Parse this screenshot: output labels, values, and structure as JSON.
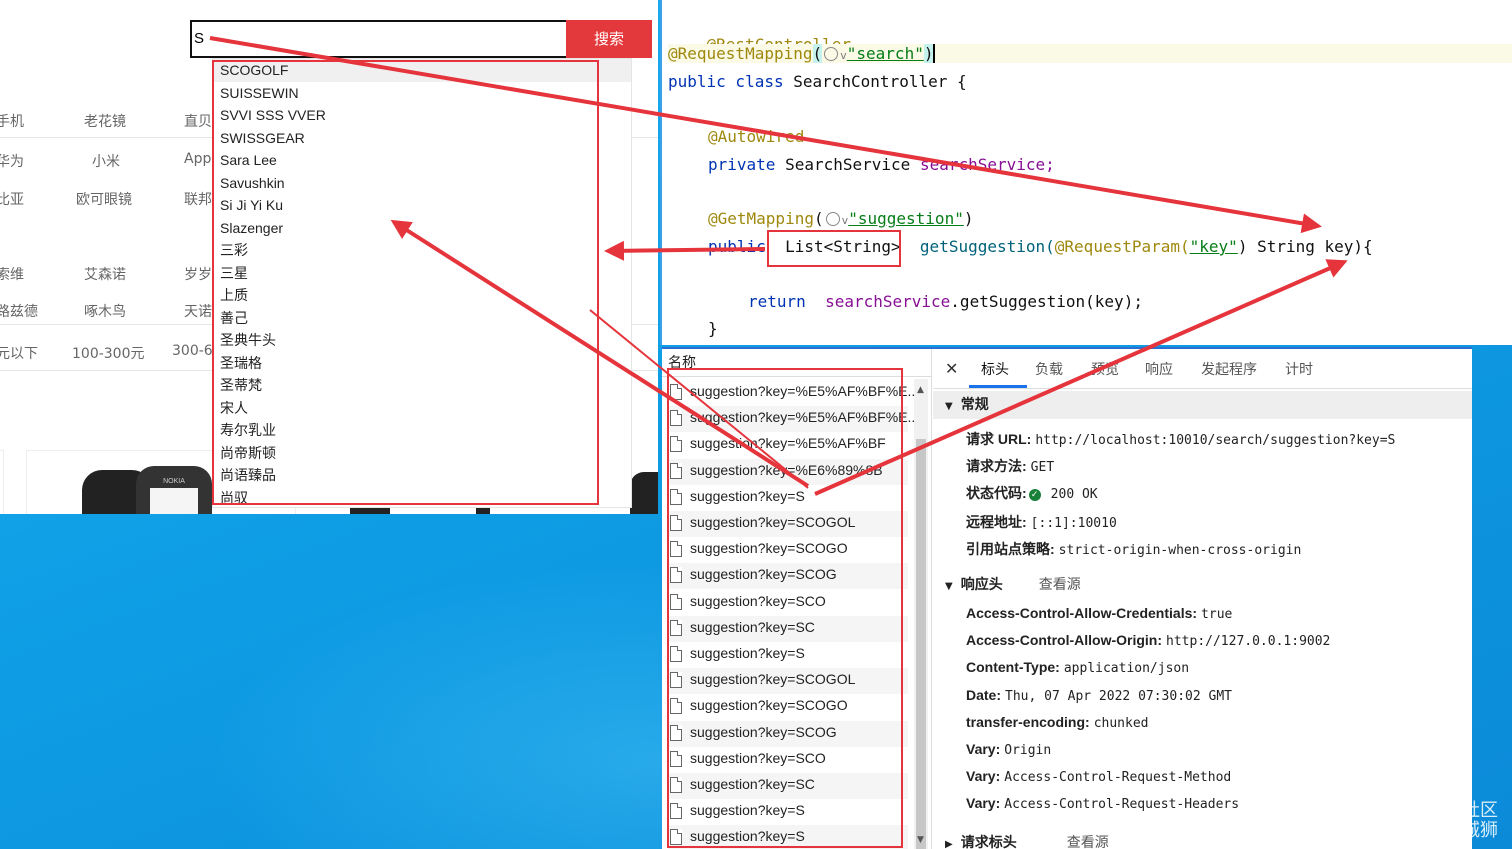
{
  "shop": {
    "search_value": "S",
    "search_button": "搜索",
    "brand_rows": [
      [
        "手机",
        "老花镜",
        "直贝"
      ],
      [
        "华为",
        "小米",
        "App"
      ],
      [
        "比亚",
        "欧可眼镜",
        "联邦"
      ],
      [
        "索维",
        "艾森诺",
        "岁岁"
      ],
      [
        "路兹德",
        "啄木鸟",
        "天诺"
      ],
      [
        "元以下",
        "100-300元",
        "300-6"
      ]
    ],
    "suggestions": [
      "SCOGOLF",
      "SUISSEWIN",
      "SVVI SSS VVER",
      "SWISSGEAR",
      "Sara Lee",
      "Savushkin",
      "Si Ji Yi Ku",
      "Slazenger",
      "三彩",
      "三星",
      "上质",
      "善己",
      "圣典牛头",
      "圣瑞格",
      "圣蒂梵",
      "宋人",
      "寿尔乳业",
      "尚帝斯顿",
      "尚语臻品",
      "尚驭"
    ],
    "phone_brand": "NOKIA"
  },
  "code": {
    "annotation_rest": "@RestController",
    "annotation_mapping": "@RequestMapping",
    "mapping_path": "\"search\"",
    "class_decl_kw": "public class",
    "class_name": "SearchController {",
    "autowired": "@Autowired",
    "private_kw": "private",
    "service_type": "SearchService",
    "service_field": "searchService;",
    "get_mapping": "@GetMapping",
    "get_path": "\"suggestion\"",
    "public_kw": "public",
    "return_type": "List<String>",
    "method_name": "getSuggestion(",
    "request_param": "@RequestParam(",
    "param_key": "\"key\"",
    "param_rest": ") String key){",
    "return_kw": "return",
    "return_expr_obj": "searchService",
    "return_expr_rest": ".getSuggestion(key);",
    "closing": "}"
  },
  "devtools": {
    "name_header": "名称",
    "requests": [
      "suggestion?key=%E5%AF%BF%E...",
      "suggestion?key=%E5%AF%BF%E...",
      "suggestion?key=%E5%AF%BF",
      "suggestion?key=%E6%89%8B",
      "suggestion?key=S",
      "suggestion?key=SCOGOL",
      "suggestion?key=SCOGO",
      "suggestion?key=SCOG",
      "suggestion?key=SCO",
      "suggestion?key=SC",
      "suggestion?key=S",
      "suggestion?key=SCOGOL",
      "suggestion?key=SCOGO",
      "suggestion?key=SCOG",
      "suggestion?key=SCO",
      "suggestion?key=SC",
      "suggestion?key=S",
      "suggestion?key=S"
    ],
    "tabs": [
      "标头",
      "负载",
      "预览",
      "响应",
      "发起程序",
      "计时"
    ],
    "general_title": "常规",
    "general": [
      {
        "k": "请求 URL:",
        "v": "http://localhost:10010/search/suggestion?key=S"
      },
      {
        "k": "请求方法:",
        "v": "GET"
      },
      {
        "k": "状态代码:",
        "v": "200 OK"
      },
      {
        "k": "远程地址:",
        "v": "[::1]:10010"
      },
      {
        "k": "引用站点策略:",
        "v": "strict-origin-when-cross-origin"
      }
    ],
    "response_headers_title": "响应头",
    "view_source": "查看源",
    "response_headers": [
      {
        "k": "Access-Control-Allow-Credentials:",
        "v": "true"
      },
      {
        "k": "Access-Control-Allow-Origin:",
        "v": "http://127.0.0.1:9002"
      },
      {
        "k": "Content-Type:",
        "v": "application/json"
      },
      {
        "k": "Date:",
        "v": "Thu, 07 Apr 2022 07:30:02 GMT"
      },
      {
        "k": "transfer-encoding:",
        "v": "chunked"
      },
      {
        "k": "Vary:",
        "v": "Origin"
      },
      {
        "k": "Vary:",
        "v": "Access-Control-Request-Method"
      },
      {
        "k": "Vary:",
        "v": "Access-Control-Request-Headers"
      }
    ],
    "request_headers_title": "请求标头",
    "request_view_source": "查看源"
  },
  "watermark": {
    "line1": "@稀土掘金技术社区",
    "line2": "CSDN @Code攻城狮"
  },
  "colors": {
    "annotation_red": "#e5343b",
    "search_button": "#e4393c",
    "desktop": "#0fa0e6",
    "tab_underline": "#1a73e8"
  }
}
